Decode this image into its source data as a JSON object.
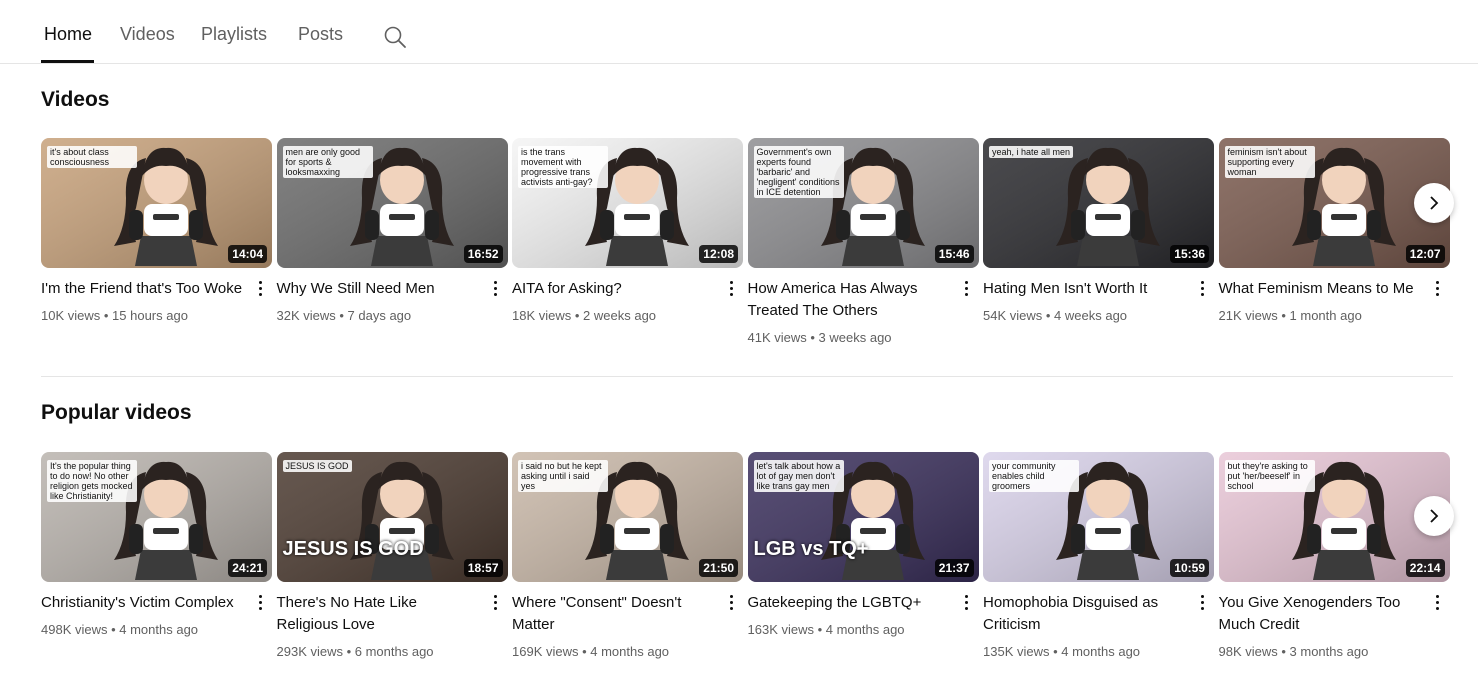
{
  "tabs": [
    {
      "label": "Home"
    },
    {
      "label": "Videos"
    },
    {
      "label": "Playlists"
    },
    {
      "label": "Posts"
    }
  ],
  "sections": {
    "videos": {
      "title": "Videos",
      "items": [
        {
          "title": "I'm the Friend that's Too Woke",
          "views": "10K views",
          "age": "15 hours ago",
          "duration": "14:04",
          "bg": "#c7a17a",
          "caption": "it's about class consciousness"
        },
        {
          "title": "Why We Still Need Men",
          "views": "32K views",
          "age": "7 days ago",
          "duration": "16:52",
          "bg": "#6b6b6b",
          "caption": "men are only good for sports & looksmaxxing"
        },
        {
          "title": "AITA for Asking?",
          "views": "18K views",
          "age": "2 weeks ago",
          "duration": "12:08",
          "bg": "#f4f4f4",
          "caption": "is the trans movement with progressive trans activists anti-gay?"
        },
        {
          "title": "How America Has Always Treated The Others",
          "views": "41K views",
          "age": "3 weeks ago",
          "duration": "15:46",
          "bg": "#8d8d90",
          "caption": "Government's own experts found 'barbaric' and 'negligent' conditions in ICE detention"
        },
        {
          "title": "Hating Men Isn't Worth It",
          "views": "54K views",
          "age": "4 weeks ago",
          "duration": "15:36",
          "bg": "#2a2a2e",
          "caption": "yeah, i hate all men"
        },
        {
          "title": "What Feminism Means to Me",
          "views": "21K views",
          "age": "1 month ago",
          "duration": "12:07",
          "bg": "#7a5a4e",
          "caption": "feminism isn't about supporting every woman"
        }
      ]
    },
    "popular": {
      "title": "Popular videos",
      "items": [
        {
          "title": "Christianity's Victim Complex",
          "views": "498K views",
          "age": "4 months ago",
          "duration": "24:21",
          "bg": "#b9b3ad",
          "caption": "It's the popular thing to do now! No other religion gets mocked like Christianity!"
        },
        {
          "title": "There's No Hate Like Religious Love",
          "views": "293K views",
          "age": "6 months ago",
          "duration": "18:57",
          "bg": "#4b3a30",
          "caption": "JESUS IS GOD",
          "bigcaption": "JESUS IS GOD"
        },
        {
          "title": "Where \"Consent\" Doesn't Matter",
          "views": "169K views",
          "age": "4 months ago",
          "duration": "21:50",
          "bg": "#c9b8a8",
          "caption": "i said no but he kept asking until i said yes"
        },
        {
          "title": "Gatekeeping the LGBTQ+",
          "views": "163K views",
          "age": "4 months ago",
          "duration": "21:37",
          "bg": "#3a2f5c",
          "caption": "let's talk about how a lot of gay men don't like trans gay men",
          "bigcaption": "LGB vs TQ+"
        },
        {
          "title": "Homophobia Disguised as Criticism",
          "views": "135K views",
          "age": "4 months ago",
          "duration": "10:59",
          "bg": "#d9d2ea",
          "caption": "your community enables child groomers"
        },
        {
          "title": "You Give Xenogenders Too Much Credit",
          "views": "98K views",
          "age": "3 months ago",
          "duration": "22:14",
          "bg": "#e8c6d6",
          "caption": "but they're asking to put 'her/beeself' in school"
        }
      ]
    }
  },
  "colors": {
    "accent": "#0f0f0f",
    "secondary_text": "#606060",
    "divider": "#e5e5e5"
  },
  "icons": {
    "search": "search-icon",
    "next": "chevron-right-icon",
    "menu": "more-vert-icon"
  }
}
